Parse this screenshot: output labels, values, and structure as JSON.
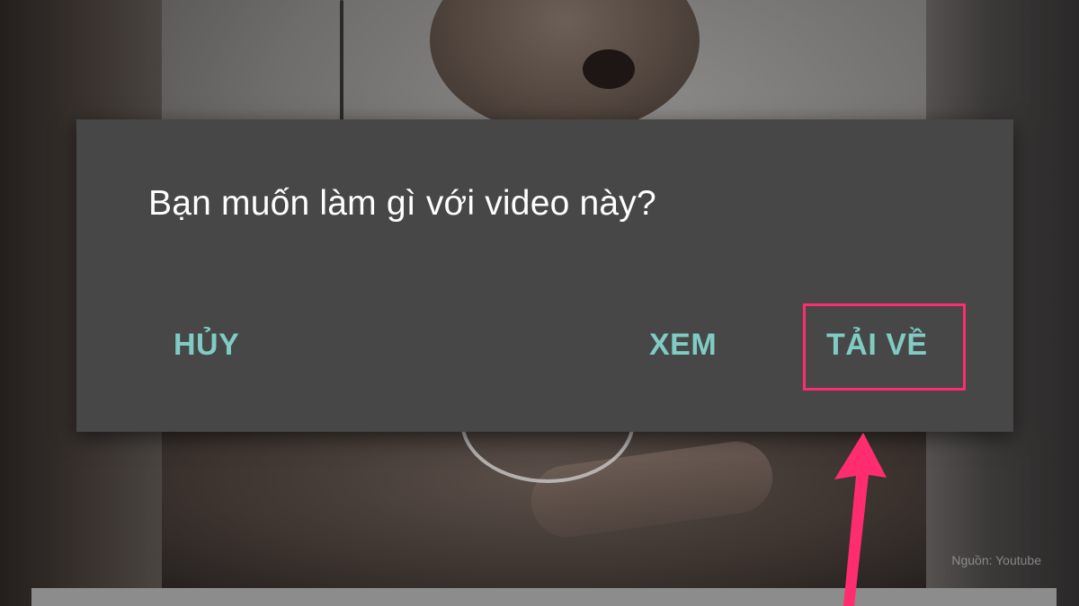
{
  "dialog": {
    "title": "Bạn muốn làm gì với video này?",
    "cancel_label": "HỦY",
    "view_label": "XEM",
    "download_label": "TẢI VỀ"
  },
  "watermark": "Nguồn: Youtube",
  "colors": {
    "dialog_bg": "#474747",
    "button_text": "#80cbc4",
    "highlight": "#ff2d6f"
  }
}
